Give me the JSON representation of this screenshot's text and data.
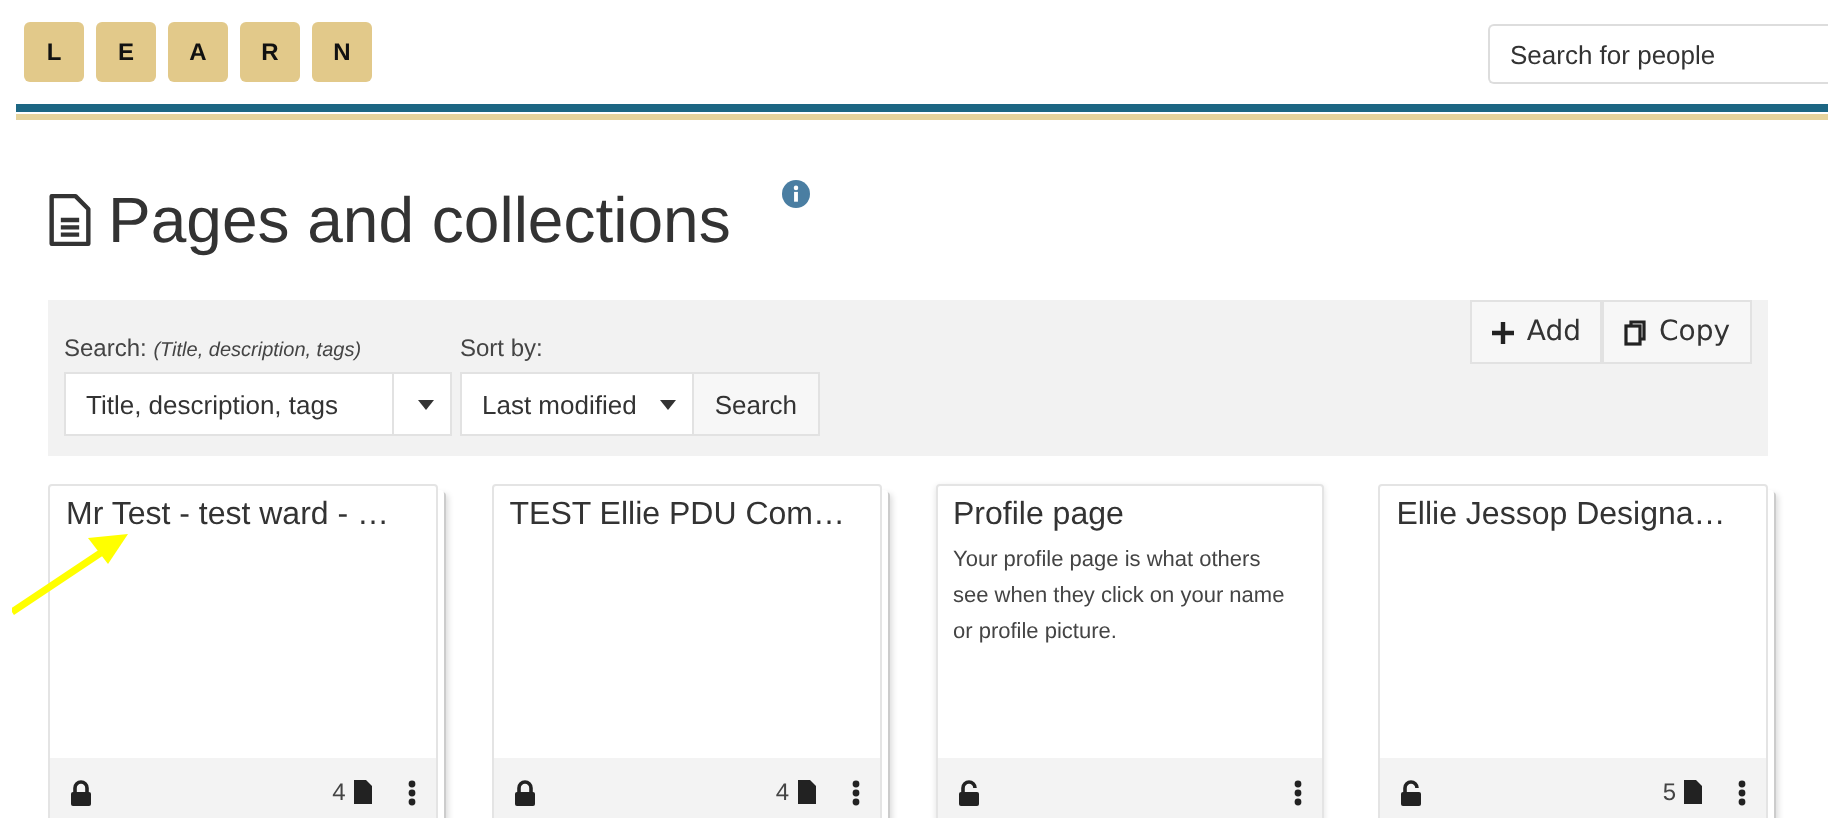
{
  "logo": {
    "letters": [
      "L",
      "E",
      "A",
      "R",
      "N"
    ]
  },
  "people_search": {
    "placeholder": "Search for people"
  },
  "heading": {
    "title": "Pages and collections"
  },
  "filters": {
    "search_label": "Search:",
    "search_hint": "(Title, description, tags)",
    "search_scope": "Title, description, tags",
    "sort_label": "Sort by:",
    "sort_value": "Last modified",
    "search_button": "Search"
  },
  "actions": [
    "Add",
    "Copy"
  ],
  "cards": [
    {
      "kind": "collection",
      "title": "Mr Test - test ward - …",
      "locked": true,
      "page_count": "4"
    },
    {
      "kind": "collection",
      "title": "TEST Ellie PDU Com…",
      "locked": true,
      "page_count": "4"
    },
    {
      "kind": "page",
      "title": "Profile page",
      "description": "Your profile page is what others see when they click on your name or profile picture.",
      "locked": false
    },
    {
      "kind": "collection",
      "title": "Ellie Jessop Designa…",
      "locked": false,
      "page_count": "5"
    }
  ]
}
